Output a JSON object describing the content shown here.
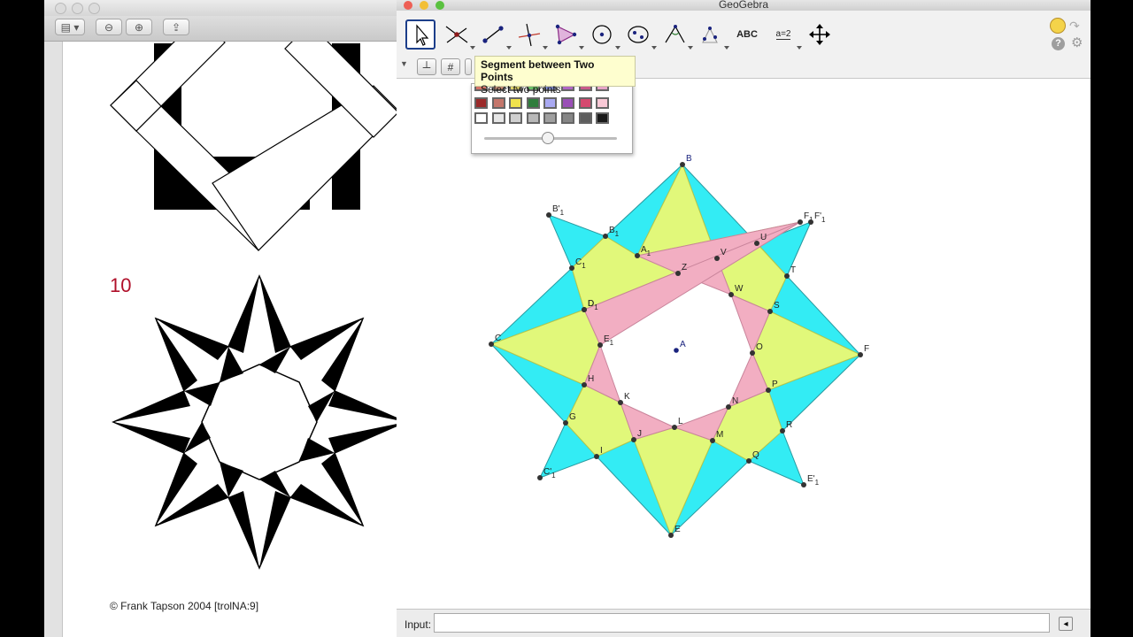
{
  "preview": {
    "page_number": "10",
    "copyright": "© Frank Tapson 2004 [trolNA:9]"
  },
  "geogebra": {
    "window_title": "GeoGebra",
    "tooltip": {
      "title": "Segment between Two Points",
      "subtitle": "Select two points"
    },
    "toolbar": {
      "text_tool_label": "ABC",
      "slider_tool_label": "a=2"
    },
    "input": {
      "label": "Input:",
      "value": ""
    },
    "points": [
      {
        "name": "A"
      },
      {
        "name": "B"
      },
      {
        "name": "C"
      },
      {
        "name": "D"
      },
      {
        "name": "E"
      },
      {
        "name": "F"
      },
      {
        "name": "G"
      },
      {
        "name": "H"
      },
      {
        "name": "I"
      },
      {
        "name": "J"
      },
      {
        "name": "K"
      },
      {
        "name": "L"
      },
      {
        "name": "M"
      },
      {
        "name": "N"
      },
      {
        "name": "O"
      },
      {
        "name": "P"
      },
      {
        "name": "Q"
      },
      {
        "name": "R"
      },
      {
        "name": "S"
      },
      {
        "name": "T"
      },
      {
        "name": "U"
      },
      {
        "name": "V"
      },
      {
        "name": "W"
      },
      {
        "name": "Z"
      },
      {
        "name": "A",
        "sub": "1"
      },
      {
        "name": "B",
        "sub": "1"
      },
      {
        "name": "C",
        "sub": "1"
      },
      {
        "name": "D",
        "sub": "1"
      },
      {
        "name": "E",
        "sub": "1"
      },
      {
        "name": "F",
        "sub": "1"
      },
      {
        "name": "B'",
        "sub": "1"
      },
      {
        "name": "C'",
        "sub": "1"
      },
      {
        "name": "E'",
        "sub": "1"
      },
      {
        "name": "F'",
        "sub": "1"
      }
    ],
    "colors": {
      "cyan_fill": "#33ecf4",
      "yellow_fill": "#e1f87a",
      "pink_fill": "#f2aec2",
      "point": "#333333",
      "center_point": "#1a237e"
    },
    "palette_rows": [
      [
        "#d47366",
        "#c9927a",
        "#e0d46a",
        "#6bbf68",
        "#8a96e0",
        "#b066c4",
        "#c95a8a",
        "#e7a5c8"
      ],
      [
        "#9b2a2a",
        "#c4766b",
        "#f0e24c",
        "#2f7d3c",
        "#a9a9f2",
        "#9a4fb7",
        "#d5496f",
        "#f9c9d6"
      ],
      [
        "#ffffff",
        "#e6e6e6",
        "#d0d0d0",
        "#b8b8b8",
        "#a0a0a0",
        "#868686",
        "#5e5e5e",
        "#1a1a1a"
      ]
    ]
  }
}
